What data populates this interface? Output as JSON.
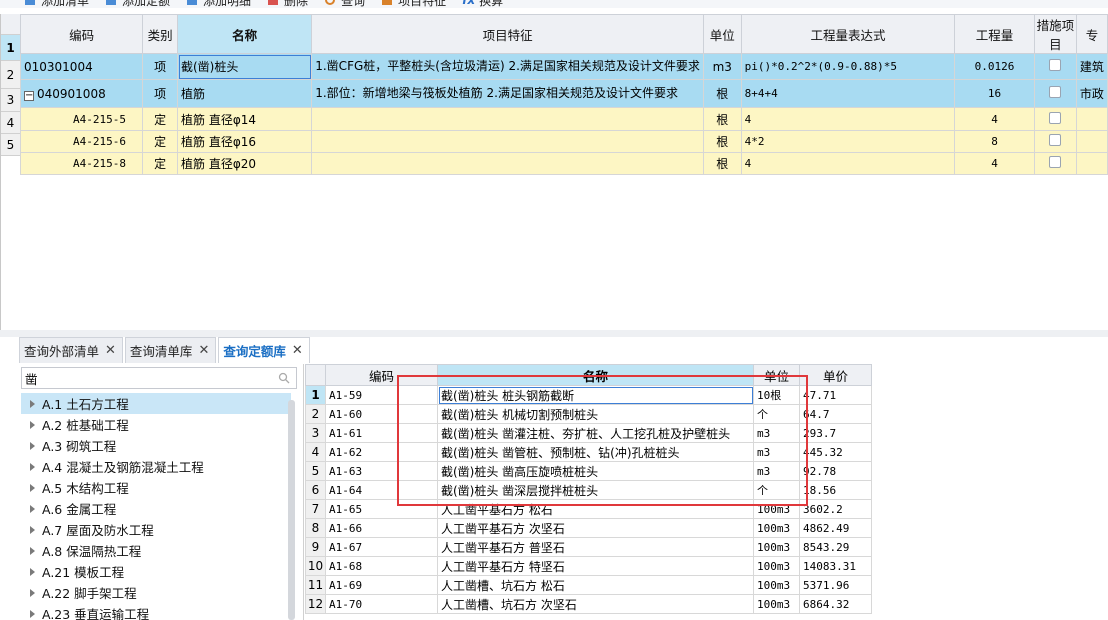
{
  "toolbar": {
    "items": [
      {
        "label": "添加清单",
        "icon": "add-list-icon"
      },
      {
        "label": "添加定额",
        "icon": "add-quota-icon"
      },
      {
        "label": "添加明细",
        "icon": "add-detail-icon"
      },
      {
        "label": "删除",
        "icon": "delete-icon"
      },
      {
        "label": "查询",
        "icon": "query-icon"
      },
      {
        "label": "项目特征",
        "icon": "feature-icon"
      },
      {
        "label": "换算",
        "icon": "fx-icon"
      }
    ]
  },
  "upper": {
    "headers": [
      "编码",
      "类别",
      "名称",
      "项目特征",
      "单位",
      "工程量表达式",
      "工程量",
      "措施项目",
      "专"
    ],
    "rows": [
      {
        "rn": "1",
        "code": "010301004",
        "type": "项",
        "name": "截(凿)桩头",
        "feature": "1.凿CFG桩，平整桩头(含垃圾清运)\n2.满足国家相关规范及设计文件要求",
        "unit": "m3",
        "expr": "pi()*0.2^2*(0.9-0.88)*5",
        "qty": "0.0126",
        "spec": "建筑"
      },
      {
        "rn": "2",
        "code": "040901008",
        "type": "项",
        "name": "植筋",
        "feature": "1.部位：新增地梁与筏板处植筋\n2.满足国家相关规范及设计文件要求",
        "unit": "根",
        "expr": "8+4+4",
        "qty": "16",
        "spec": "市政"
      },
      {
        "rn": "3",
        "code": "A4-215-5",
        "type": "定",
        "name": "植筋 直径φ14",
        "feature": "",
        "unit": "根",
        "expr": "4",
        "qty": "4",
        "spec": ""
      },
      {
        "rn": "4",
        "code": "A4-215-6",
        "type": "定",
        "name": "植筋 直径φ16",
        "feature": "",
        "unit": "根",
        "expr": "4*2",
        "qty": "8",
        "spec": ""
      },
      {
        "rn": "5",
        "code": "A4-215-8",
        "type": "定",
        "name": "植筋 直径φ20",
        "feature": "",
        "unit": "根",
        "expr": "4",
        "qty": "4",
        "spec": ""
      }
    ],
    "collapse_symbol": "−"
  },
  "tabs": [
    {
      "label": "查询外部清单",
      "active": false
    },
    {
      "label": "查询清单库",
      "active": false
    },
    {
      "label": "查询定额库",
      "active": true
    }
  ],
  "search": {
    "value": "凿"
  },
  "tree": [
    {
      "label": "A.1 土石方工程",
      "selected": true
    },
    {
      "label": "A.2 桩基础工程",
      "selected": false
    },
    {
      "label": "A.3 砌筑工程",
      "selected": false
    },
    {
      "label": "A.4 混凝土及钢筋混凝土工程",
      "selected": false
    },
    {
      "label": "A.5 木结构工程",
      "selected": false
    },
    {
      "label": "A.6 金属工程",
      "selected": false
    },
    {
      "label": "A.7 屋面及防水工程",
      "selected": false
    },
    {
      "label": "A.8 保温隔热工程",
      "selected": false
    },
    {
      "label": "A.21 模板工程",
      "selected": false
    },
    {
      "label": "A.22 脚手架工程",
      "selected": false
    },
    {
      "label": "A.23 垂直运输工程",
      "selected": false
    }
  ],
  "lower": {
    "headers": [
      "",
      "编码",
      "名称",
      "单位",
      "单价"
    ],
    "rows": [
      {
        "rn": "1",
        "code": "A1-59",
        "name": "截(凿)桩头 桩头钢筋截断",
        "unit": "10根",
        "price": "47.71"
      },
      {
        "rn": "2",
        "code": "A1-60",
        "name": "截(凿)桩头 机械切割预制桩头",
        "unit": "个",
        "price": "64.7"
      },
      {
        "rn": "3",
        "code": "A1-61",
        "name": "截(凿)桩头 凿灌注桩、夯扩桩、人工挖孔桩及护壁桩头",
        "unit": "m3",
        "price": "293.7"
      },
      {
        "rn": "4",
        "code": "A1-62",
        "name": "截(凿)桩头 凿管桩、预制桩、钻(冲)孔桩桩头",
        "unit": "m3",
        "price": "445.32"
      },
      {
        "rn": "5",
        "code": "A1-63",
        "name": "截(凿)桩头 凿高压旋喷桩桩头",
        "unit": "m3",
        "price": "92.78"
      },
      {
        "rn": "6",
        "code": "A1-64",
        "name": "截(凿)桩头 凿深层搅拌桩桩头",
        "unit": "个",
        "price": "18.56"
      },
      {
        "rn": "7",
        "code": "A1-65",
        "name": "人工凿平基石方 松石",
        "unit": "100m3",
        "price": "3602.2"
      },
      {
        "rn": "8",
        "code": "A1-66",
        "name": "人工凿平基石方 次坚石",
        "unit": "100m3",
        "price": "4862.49"
      },
      {
        "rn": "9",
        "code": "A1-67",
        "name": "人工凿平基石方 普坚石",
        "unit": "100m3",
        "price": "8543.29"
      },
      {
        "rn": "10",
        "code": "A1-68",
        "name": "人工凿平基石方 特坚石",
        "unit": "100m3",
        "price": "14083.31"
      },
      {
        "rn": "11",
        "code": "A1-69",
        "name": "人工凿槽、坑石方 松石",
        "unit": "100m3",
        "price": "5371.96"
      },
      {
        "rn": "12",
        "code": "A1-70",
        "name": "人工凿槽、坑石方 次坚石",
        "unit": "100m3",
        "price": "6864.32"
      }
    ]
  },
  "colors": {
    "selected_row": "#a8dbf2",
    "quota_row": "#fdf6c4",
    "highlight": "#e0383b",
    "active_tab": "#1b6fc4"
  }
}
